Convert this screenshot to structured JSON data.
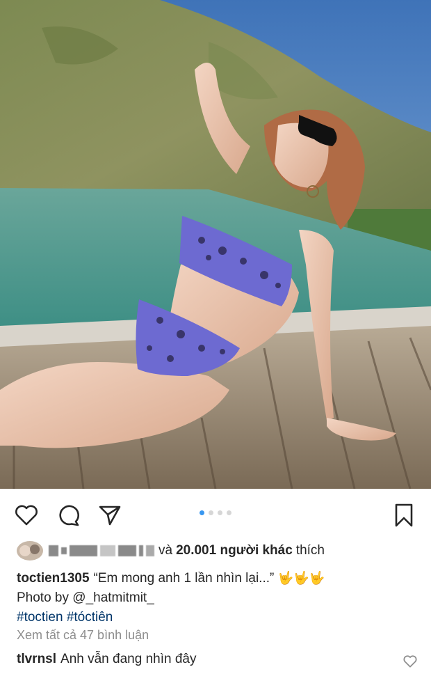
{
  "post": {
    "photo_alt": "Woman in a purple leopard-print bikini and sunglasses posing on a wooden pool deck with a hillside in the background"
  },
  "actions": {
    "like_icon": "heart-icon",
    "comment_icon": "comment-icon",
    "share_icon": "send-icon",
    "save_icon": "bookmark-icon"
  },
  "carousel": {
    "total": 4,
    "active_index": 0
  },
  "likes": {
    "connector": "và",
    "count_text": "20.001 người khác",
    "suffix": "thích"
  },
  "caption": {
    "username": "toctien1305",
    "text": "“Em mong anh 1 lần nhìn lại...”",
    "emoji": "🤟🤟🤟",
    "photo_credit": "Photo by @_hatmitmit_",
    "hashtags": "#toctien #tóctiên"
  },
  "view_comments": "Xem tất cả 47 bình luận",
  "comment": {
    "username": "tlvrnsl",
    "text": "Anh vẫn đang nhìn đây"
  }
}
